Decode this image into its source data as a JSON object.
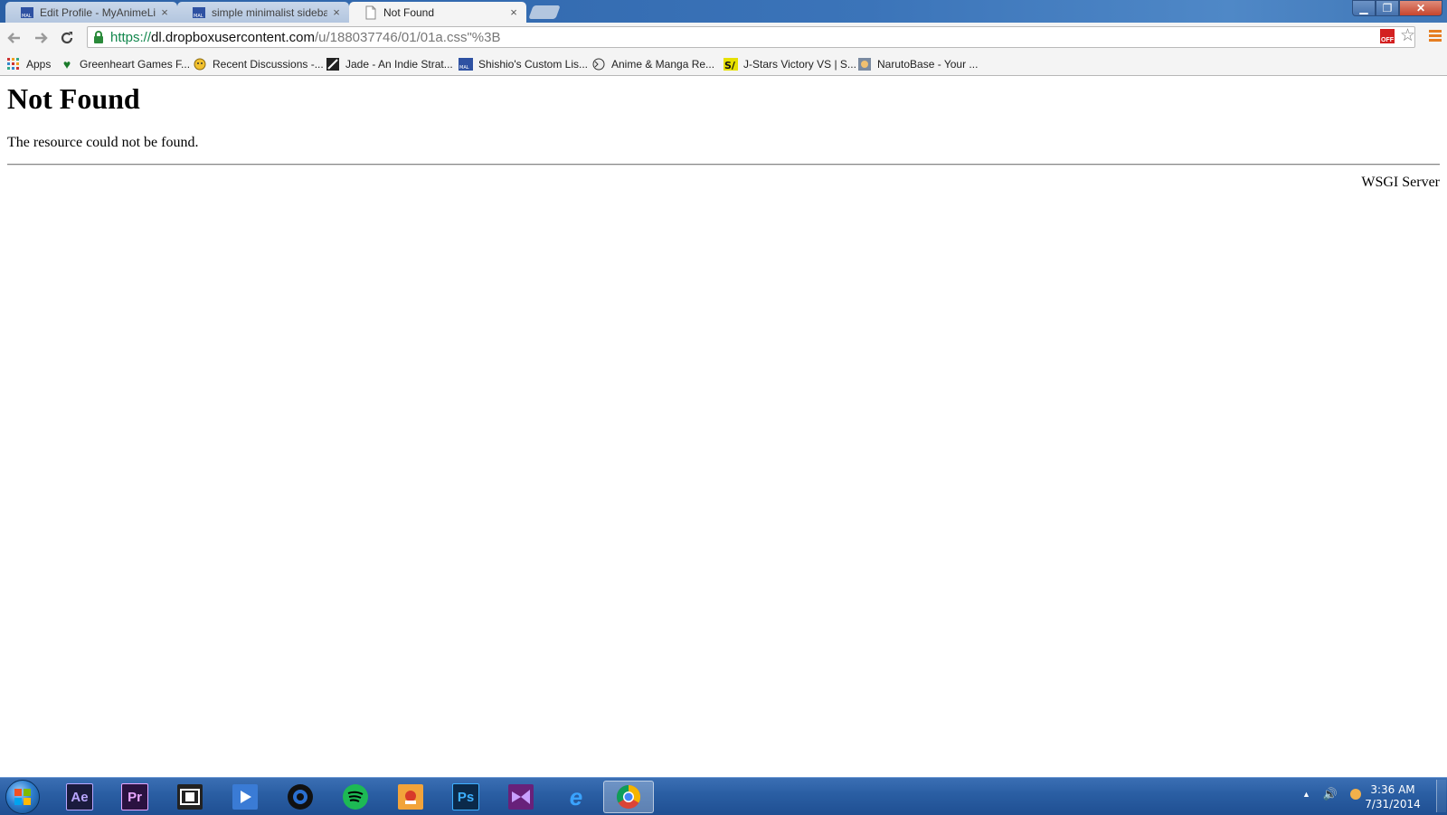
{
  "browser": {
    "tabs": [
      {
        "label": "Edit Profile - MyAnimeList",
        "icon": "mal-icon",
        "active": false
      },
      {
        "label": "simple minimalist sidebar",
        "icon": "mal-icon",
        "active": false
      },
      {
        "label": "Not Found",
        "icon": "page-icon",
        "active": true
      }
    ],
    "close_glyph": "×",
    "url": {
      "scheme": "https://",
      "host": "dl.dropboxusercontent.com",
      "path": "/u/188037746/01/01a.css\"%3B"
    },
    "extension_label": "OFF",
    "bookmarks": [
      {
        "label": "Apps",
        "icon": "apps-grid-icon"
      },
      {
        "label": "Greenheart Games F...",
        "icon": "heart-icon"
      },
      {
        "label": "Recent Discussions -...",
        "icon": "forum-icon"
      },
      {
        "label": "Jade - An Indie Strat...",
        "icon": "jade-icon"
      },
      {
        "label": "Shishio's Custom Lis...",
        "icon": "mal-icon"
      },
      {
        "label": "Anime & Manga Re...",
        "icon": "anime-icon"
      },
      {
        "label": "J-Stars Victory VS | S...",
        "icon": "jstars-icon"
      },
      {
        "label": "NarutoBase - Your ...",
        "icon": "naruto-icon"
      }
    ]
  },
  "page": {
    "heading": "Not Found",
    "message": "The resource could not be found.",
    "server": "WSGI Server"
  },
  "taskbar": {
    "apps": [
      {
        "name": "after-effects",
        "label": "Ae",
        "bg": "#1a1b3d",
        "fg": "#b9a6ff"
      },
      {
        "name": "premiere",
        "label": "Pr",
        "bg": "#2a1240",
        "fg": "#e9a6ff"
      },
      {
        "name": "movie-maker",
        "label": "",
        "bg": "#222222",
        "fg": "#ffffff"
      },
      {
        "name": "media-player",
        "label": "",
        "bg": "#3a7bd5",
        "fg": "#ffffff"
      },
      {
        "name": "camera-app",
        "label": "",
        "bg": "#111111",
        "fg": "#3aa0ff"
      },
      {
        "name": "spotify",
        "label": "",
        "bg": "#1db954",
        "fg": "#000000"
      },
      {
        "name": "game-app",
        "label": "",
        "bg": "#f2a33a",
        "fg": "#ffffff"
      },
      {
        "name": "photoshop",
        "label": "Ps",
        "bg": "#0b2a4a",
        "fg": "#3db0ff"
      },
      {
        "name": "visual-studio",
        "label": "",
        "bg": "#68217a",
        "fg": "#ffffff"
      },
      {
        "name": "internet-explorer",
        "label": "e",
        "bg": "transparent",
        "fg": "#3aa3ff"
      },
      {
        "name": "chrome",
        "label": "",
        "bg": "transparent",
        "fg": "#ffffff"
      }
    ],
    "clock_time": "3:36 AM",
    "clock_date": "7/31/2014"
  }
}
